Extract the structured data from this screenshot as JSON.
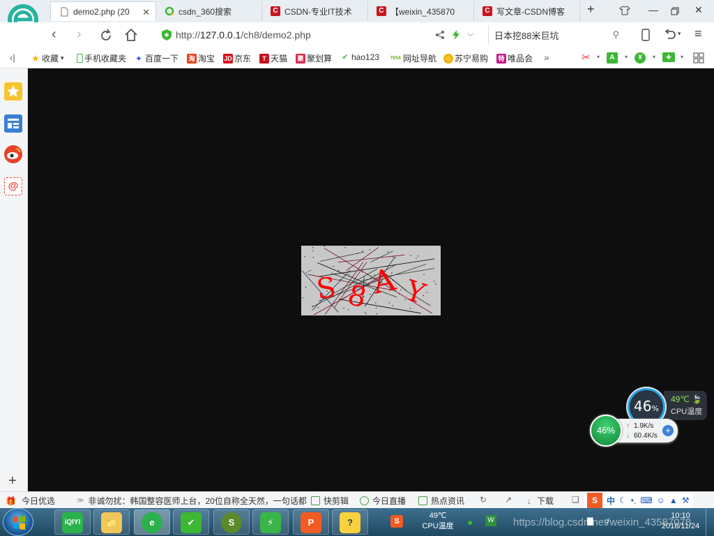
{
  "tabs": [
    {
      "label": "demo2.php (20",
      "active": true
    },
    {
      "label": "csdn_360搜索",
      "active": false
    },
    {
      "label": "CSDN-专业IT技术",
      "active": false
    },
    {
      "label": "【weixin_435870",
      "active": false
    },
    {
      "label": "写文章-CSDN博客",
      "active": false
    }
  ],
  "address": {
    "scheme": "http://",
    "host": "127.0.0.1",
    "path": "/ch8/demo2.php"
  },
  "search": {
    "text": "日本挖88米巨坑"
  },
  "bookmarks": [
    {
      "label": "收藏",
      "icon": "star-icon",
      "color": "#f5b400"
    },
    {
      "label": "手机收藏夹",
      "icon": "phone-icon",
      "color": "#4caf50"
    },
    {
      "label": "百度一下",
      "icon": "baidu-icon",
      "color": "#2f5bd9"
    },
    {
      "label": "淘宝",
      "icon": "taobao-icon",
      "color": "#e8431f"
    },
    {
      "label": "京东",
      "icon": "jd-icon",
      "color": "#d4101d"
    },
    {
      "label": "天猫",
      "icon": "tmall-icon",
      "color": "#c8101d"
    },
    {
      "label": "聚划算",
      "icon": "juhuasuan-icon",
      "color": "#d92c4f"
    },
    {
      "label": "hao123",
      "icon": "hao123-icon",
      "color": "#4caf50"
    },
    {
      "label": "网址导航",
      "icon": "nav-icon",
      "color": "#7ab51d"
    },
    {
      "label": "苏宁易购",
      "icon": "suning-icon",
      "color": "#f5b400"
    },
    {
      "label": "唯品会",
      "icon": "vip-icon",
      "color": "#c5198a"
    }
  ],
  "bookmark_more": "»",
  "captcha": {
    "chars": [
      "S",
      "8",
      "A",
      "Y"
    ],
    "color": "#ff0000",
    "background": "#c8c8c8"
  },
  "cpu_widget": {
    "percent": "46",
    "unit": "%",
    "temp": "49℃",
    "label": "CPU温度"
  },
  "net_widget": {
    "percent": "46%",
    "up": "1.9K/s",
    "down": "60.4K/s"
  },
  "statusbar": {
    "today": "今日优选",
    "news": "非诚勿扰：韩国整容医师上台，20位自称全天然，一句话都",
    "items": [
      "快剪辑",
      "今日直播",
      "热点资讯"
    ],
    "download": "下载"
  },
  "taskbar": {
    "cpu_temp": "49℃",
    "cpu_label": "CPU温度",
    "time": "10:10",
    "date": "2018/11/24",
    "watermark": "https://blog.csdn.net/weixin_43587078"
  }
}
